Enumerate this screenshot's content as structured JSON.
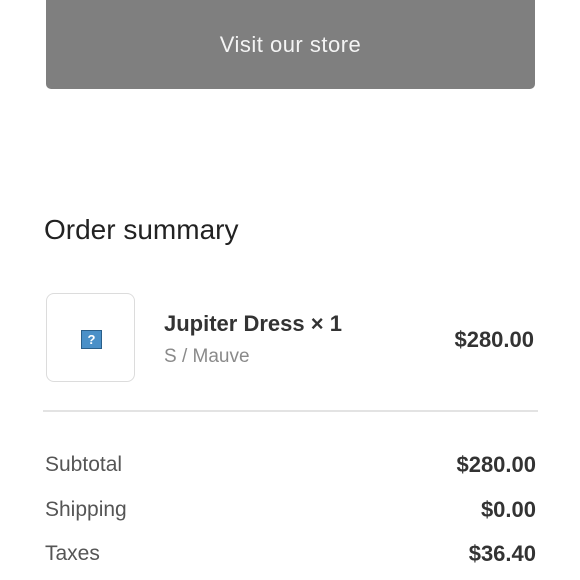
{
  "store_button": {
    "label": "Visit our store"
  },
  "order_summary": {
    "title": "Order summary",
    "item": {
      "name": "Jupiter Dress × 1",
      "variant": "S / Mauve",
      "price": "$280.00",
      "image_icon": "broken-image-icon",
      "image_glyph": "?"
    },
    "rows": [
      {
        "label": "Subtotal",
        "value": "$280.00"
      },
      {
        "label": "Shipping",
        "value": "$0.00"
      },
      {
        "label": "Taxes",
        "value": "$36.40"
      }
    ]
  },
  "colors": {
    "button_bg": "#7f7f7f",
    "button_text": "#f4f4f4",
    "divider": "#e3e3e3"
  }
}
